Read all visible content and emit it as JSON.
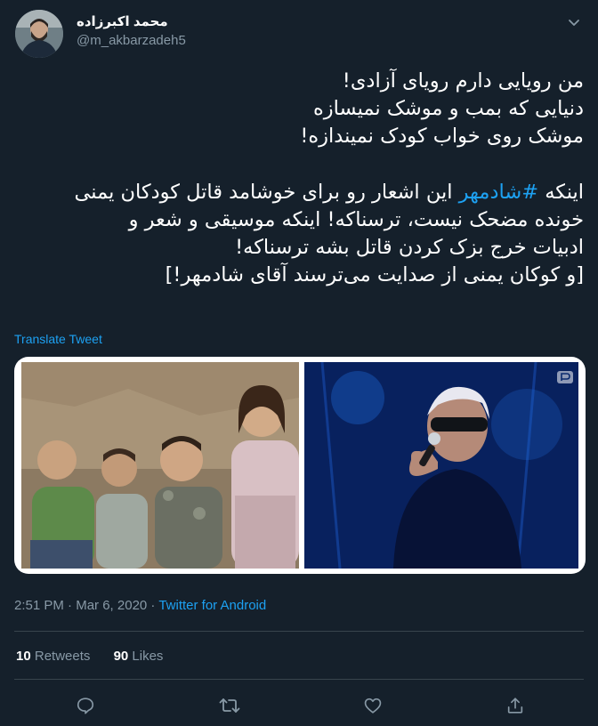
{
  "user": {
    "name": "محمد اکبرزاده",
    "handle": "@m_akbarzadeh5"
  },
  "tweet": {
    "lines": [
      "من رویایی دارم رویای آزادی!",
      "دنیایی که بمب و موشک نمیسازه",
      "موشک روی خواب کودک نمیندازه!"
    ],
    "p2_prefix": "اینکه ",
    "hashtag": "#شادمهر",
    "p2_rest": " این اشعار رو برای خوشامد قاتل کودکان یمنی",
    "lines2": [
      "خونده مضحک نیست، ترسناکه! اینکه موسیقی و شعر و",
      "ادبیات خرج بزک کردن قاتل بشه ترسناکه!",
      "[و کوکان یمنی از صدایت می‌ترسند آقای شادمهر!]"
    ],
    "translate_label": "Translate Tweet"
  },
  "meta": {
    "time": "2:51 PM",
    "separator": " · ",
    "date": "Mar 6, 2020",
    "source": "Twitter for Android"
  },
  "stats": {
    "retweets_count": "10",
    "retweets_label": " Retweets",
    "likes_count": "90",
    "likes_label": " Likes"
  },
  "actions": [
    "reply-icon",
    "retweet-icon",
    "like-icon",
    "share-icon"
  ],
  "colors": {
    "background": "#15202b",
    "accent": "#1da1f2",
    "secondary_text": "#8899a6",
    "divider": "#38444d"
  }
}
